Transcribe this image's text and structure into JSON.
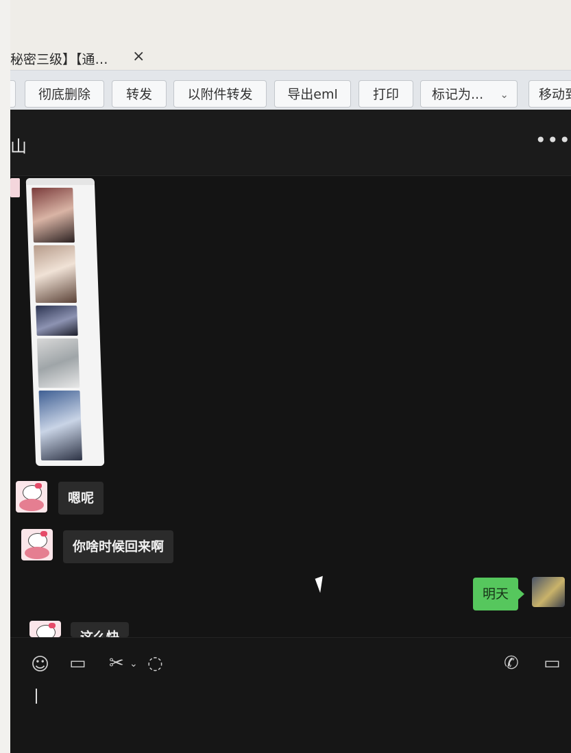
{
  "tab": {
    "title": "秘密三级】【通…",
    "close_symbol": "×"
  },
  "toolbar": {
    "buttons": [
      "彻底删除",
      "转发",
      "以附件转发",
      "导出eml",
      "打印",
      "标记为...",
      "移动到"
    ]
  },
  "chat": {
    "contact_name": "山",
    "more_symbol": "•••",
    "messages": [
      {
        "from": "them",
        "type": "image-collage"
      },
      {
        "from": "them",
        "type": "text",
        "text": "嗯呢"
      },
      {
        "from": "them",
        "type": "text",
        "text": "你啥时候回来啊"
      },
      {
        "from": "me",
        "type": "text",
        "text": "明天"
      },
      {
        "from": "them",
        "type": "text",
        "text": "这么快"
      }
    ]
  },
  "composer": {
    "icons": [
      "emoji-icon",
      "folder-icon",
      "scissors-icon",
      "chat-bubble-icon",
      "phone-icon",
      "video-icon"
    ]
  },
  "colors": {
    "chat_bg": "#141414",
    "bubble_in": "#2b2b2b",
    "bubble_out": "#56c75d",
    "toolbar_bg": "#e3e6ea"
  }
}
